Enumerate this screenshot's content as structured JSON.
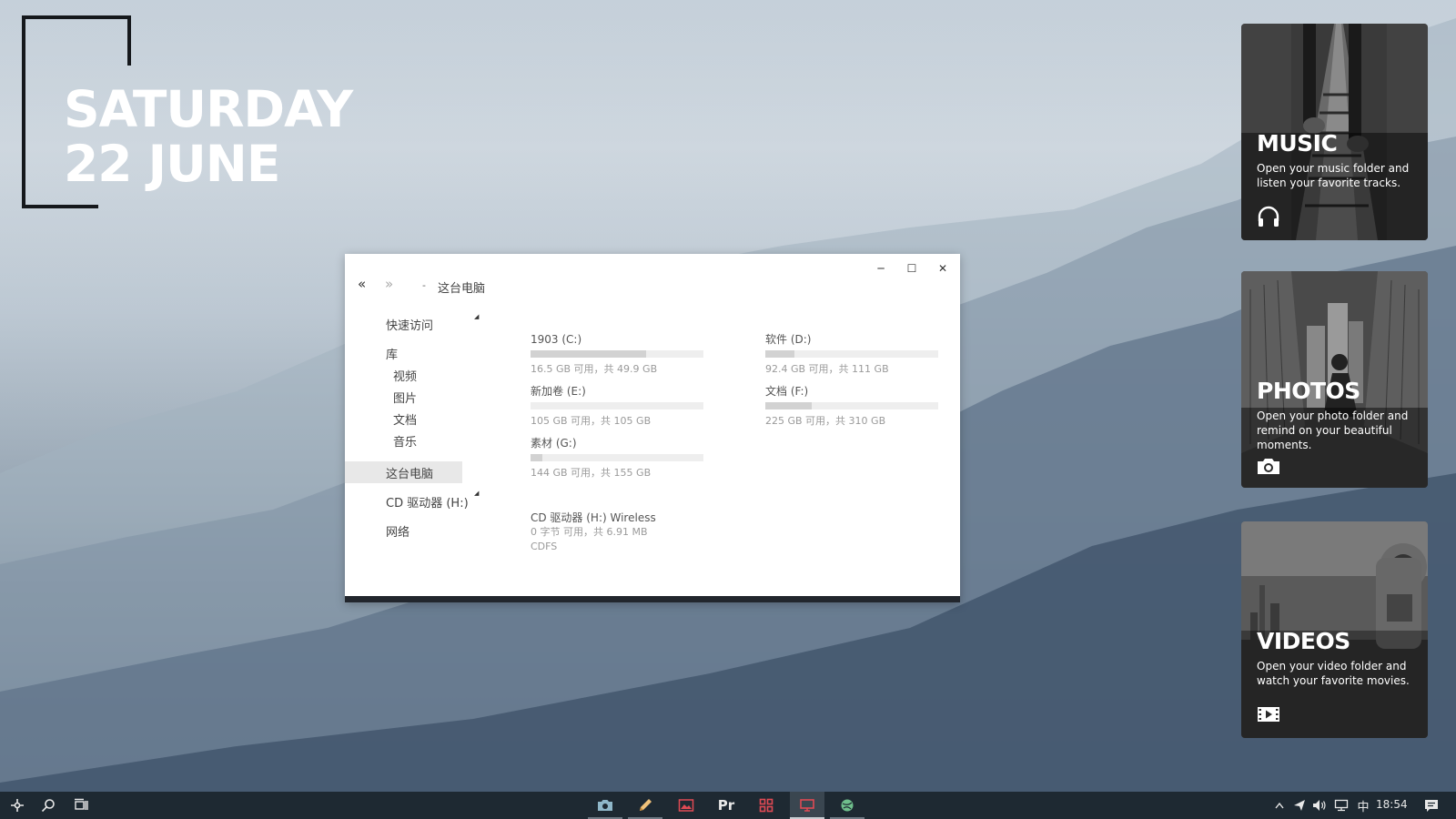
{
  "desktop": {
    "day": "SATURDAY",
    "date": "22 JUNE"
  },
  "explorer": {
    "window_buttons": {
      "minimize": "─",
      "maximize": "☐",
      "close": "✕"
    },
    "nav": {
      "back": "«",
      "forward": "»"
    },
    "address": "这台电脑",
    "sidebar": {
      "quick_access": "快速访问",
      "library": "库",
      "videos": "视频",
      "pictures": "图片",
      "documents": "文档",
      "music": "音乐",
      "this_pc": "这台电脑",
      "cd_drive": "CD 驱动器 (H:)",
      "network": "网络"
    },
    "drives": [
      {
        "name": "1903 (C:)",
        "info": "16.5 GB 可用，共 49.9 GB",
        "used_fraction": 0.67
      },
      {
        "name": "软件 (D:)",
        "info": "92.4 GB 可用，共 111 GB",
        "used_fraction": 0.17
      },
      {
        "name": "新加卷 (E:)",
        "info": "105 GB 可用，共 105 GB",
        "used_fraction": 0.0
      },
      {
        "name": "文档 (F:)",
        "info": "225 GB 可用，共 310 GB",
        "used_fraction": 0.27
      },
      {
        "name": "素材 (G:)",
        "info": "144 GB 可用，共 155 GB",
        "used_fraction": 0.07
      }
    ],
    "cd": {
      "name": "CD 驱动器 (H:) Wireless",
      "info": "0 字节 可用，共 6.91 MB",
      "fs": "CDFS"
    }
  },
  "cards": {
    "music": {
      "title": "MUSIC",
      "desc": "Open your music folder and listen your favorite tracks.",
      "icon": "headphones-icon"
    },
    "photos": {
      "title": "PHOTOS",
      "desc": "Open your photo folder and remind on your beautiful moments.",
      "icon": "camera-icon"
    },
    "videos": {
      "title": "VIDEOS",
      "desc": "Open your video folder and watch your favorite movies.",
      "icon": "film-icon"
    }
  },
  "taskbar": {
    "app_icons": [
      "start-icon",
      "search-icon",
      "task-view-icon",
      "camera-app-icon",
      "pen-app-icon",
      "picture-app-icon",
      "premiere-icon",
      "grid-app-icon",
      "monitor-app-icon",
      "globe-app-icon"
    ],
    "premiere_label": "Pr",
    "ime": "中",
    "time": "18:54",
    "accent": "#e04a54"
  }
}
